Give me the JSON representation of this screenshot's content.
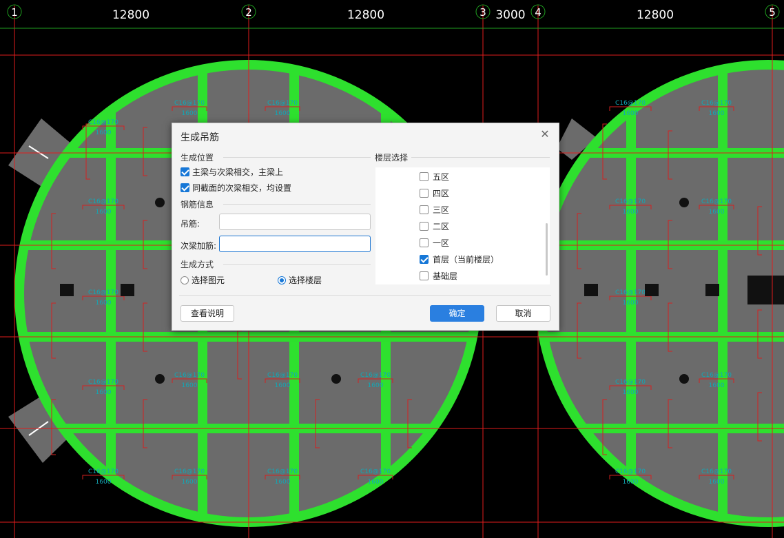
{
  "axes": {
    "labels": [
      "1",
      "2",
      "3",
      "4",
      "5"
    ],
    "dims": [
      "12800",
      "12800",
      "3000",
      "12800"
    ]
  },
  "drawing": {
    "beam_label": "C16@170",
    "beam_length": "1600"
  },
  "dialog": {
    "title": "生成吊筋",
    "close_glyph": "✕",
    "section_position": "生成位置",
    "opt_main_secondary": "主梁与次梁相交，主梁上",
    "opt_main_secondary_checked": true,
    "opt_same_section": "同截面的次梁相交，均设置",
    "opt_same_section_checked": true,
    "section_rebar": "钢筋信息",
    "hanger_label": "吊筋:",
    "hanger_value": "",
    "secondary_label": "次梁加筋:",
    "secondary_value": "",
    "section_method": "生成方式",
    "radio_select_element": "选择图元",
    "radio_select_floor": "选择楼层",
    "radio_selected": "select_floor",
    "floor_section": "楼层选择",
    "floors": [
      {
        "label": "五区",
        "checked": false
      },
      {
        "label": "四区",
        "checked": false
      },
      {
        "label": "三区",
        "checked": false
      },
      {
        "label": "二区",
        "checked": false
      },
      {
        "label": "一区",
        "checked": false
      },
      {
        "label": "首层（当前楼层）",
        "checked": true
      },
      {
        "label": "基础层",
        "checked": false
      }
    ],
    "help_button": "查看说明",
    "ok_button": "确定",
    "cancel_button": "取消"
  },
  "colors": {
    "background": "#000000",
    "beam_green": "#2ee02e",
    "slab_gray": "#6b6b6b",
    "axis_red": "#e01c1c",
    "grid_green": "#1fa01f",
    "rebar_red": "#d42020",
    "rebar_text": "#13a7b5",
    "primary_blue": "#2a7fe0"
  }
}
